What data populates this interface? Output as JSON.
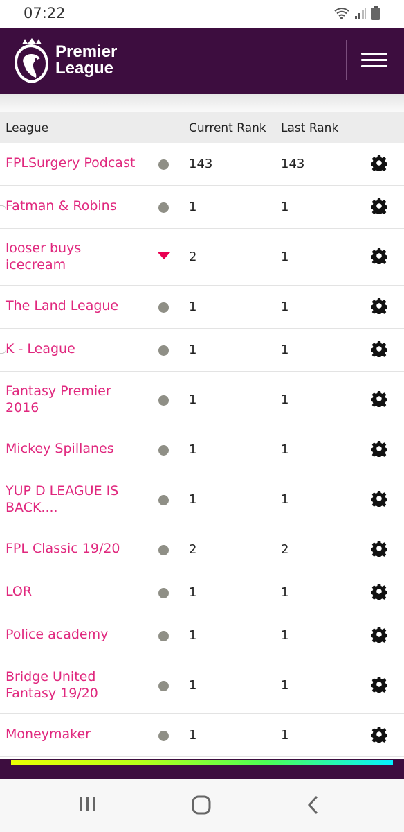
{
  "status_bar": {
    "time": "07:22",
    "icons": [
      "wifi-icon",
      "signal-icon",
      "battery-icon"
    ]
  },
  "header": {
    "brand_line1": "Premier",
    "brand_line2": "League",
    "logo_icon": "lion-crest-icon",
    "menu_icon": "hamburger-menu-icon",
    "background_color": "#3d0d3f"
  },
  "table": {
    "headers": {
      "league": "League",
      "current_rank": "Current Rank",
      "last_rank": "Last Rank"
    },
    "rows": [
      {
        "name_line1": "FPLSurgery Podcast",
        "name_line2": "",
        "movement": "same",
        "current_rank": "143",
        "last_rank": "143"
      },
      {
        "name_line1": "Fatman & Robins",
        "name_line2": "",
        "movement": "same",
        "current_rank": "1",
        "last_rank": "1"
      },
      {
        "name_line1": "looser buys",
        "name_line2": "icecream",
        "movement": "down",
        "current_rank": "2",
        "last_rank": "1"
      },
      {
        "name_line1": "The Land League",
        "name_line2": "",
        "movement": "same",
        "current_rank": "1",
        "last_rank": "1"
      },
      {
        "name_line1": "K - League",
        "name_line2": "",
        "movement": "same",
        "current_rank": "1",
        "last_rank": "1"
      },
      {
        "name_line1": "Fantasy Premier",
        "name_line2": "2016",
        "movement": "same",
        "current_rank": "1",
        "last_rank": "1"
      },
      {
        "name_line1": "Mickey Spillanes",
        "name_line2": "",
        "movement": "same",
        "current_rank": "1",
        "last_rank": "1"
      },
      {
        "name_line1": "YUP D LEAGUE IS",
        "name_line2": "BACK....",
        "movement": "same",
        "current_rank": "1",
        "last_rank": "1"
      },
      {
        "name_line1": "FPL Classic 19/20",
        "name_line2": "",
        "movement": "same",
        "current_rank": "2",
        "last_rank": "2"
      },
      {
        "name_line1": "LOR",
        "name_line2": "",
        "movement": "same",
        "current_rank": "1",
        "last_rank": "1"
      },
      {
        "name_line1": "Police academy",
        "name_line2": "",
        "movement": "same",
        "current_rank": "1",
        "last_rank": "1"
      },
      {
        "name_line1": "Bridge United",
        "name_line2": "Fantasy 19/20",
        "movement": "same",
        "current_rank": "1",
        "last_rank": "1"
      },
      {
        "name_line1": "Moneymaker",
        "name_line2": "",
        "movement": "same",
        "current_rank": "1",
        "last_rank": "1"
      }
    ],
    "link_color": "#e0287e",
    "down_color": "#e90052",
    "same_color": "#8f8f86"
  },
  "nav_bar": {
    "buttons": [
      "recent-apps-icon",
      "home-icon",
      "back-icon"
    ]
  }
}
